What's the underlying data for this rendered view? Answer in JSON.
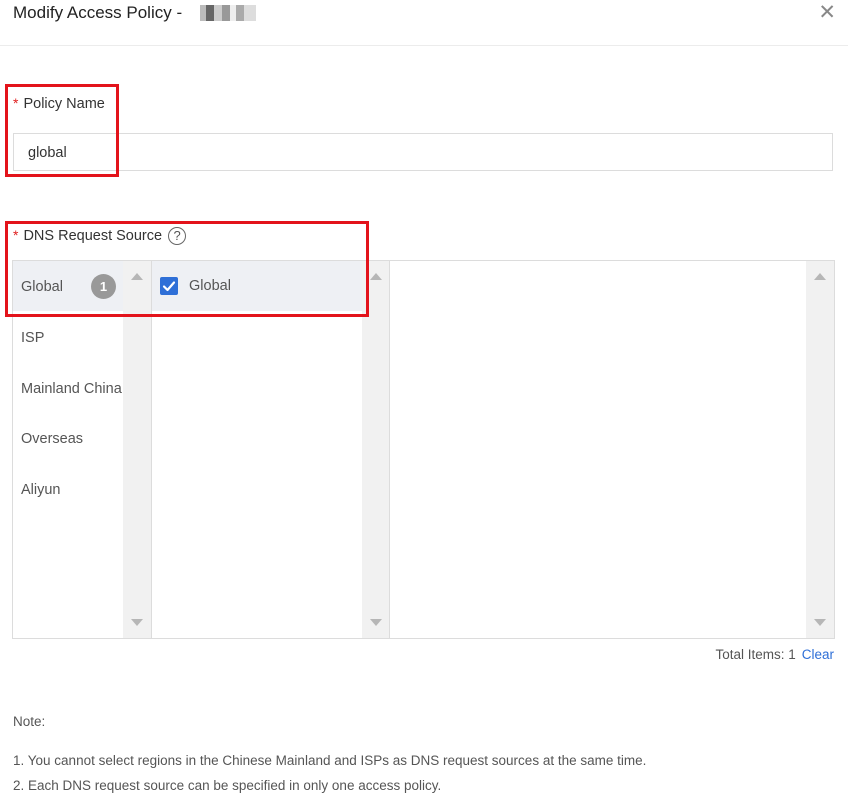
{
  "dialog": {
    "title": "Modify Access Policy -"
  },
  "policy_name": {
    "required_mark": "*",
    "label": "Policy Name",
    "value": "global"
  },
  "dns_source": {
    "required_mark": "*",
    "label": "DNS Request Source",
    "help_glyph": "?",
    "categories": [
      {
        "label": "Global",
        "badge": "1",
        "selected": true
      },
      {
        "label": "ISP"
      },
      {
        "label": "Mainland China"
      },
      {
        "label": "Overseas"
      },
      {
        "label": "Aliyun"
      }
    ],
    "options": [
      {
        "label": "Global",
        "checked": true
      }
    ],
    "total_items_label": "Total Items: 1",
    "clear_label": "Clear"
  },
  "notes": {
    "heading": "Note:",
    "items": [
      "1. You cannot select regions in the Chinese Mainland and ISPs as DNS request sources at the same time.",
      "2. Each DNS request source can be specified in only one access policy."
    ]
  },
  "colors": {
    "accent": "#2e6fd7",
    "required": "#e02020",
    "highlight_box": "#e3131b"
  },
  "icons": {
    "close": "close-icon",
    "help": "question-circle-icon",
    "check": "check-icon"
  }
}
